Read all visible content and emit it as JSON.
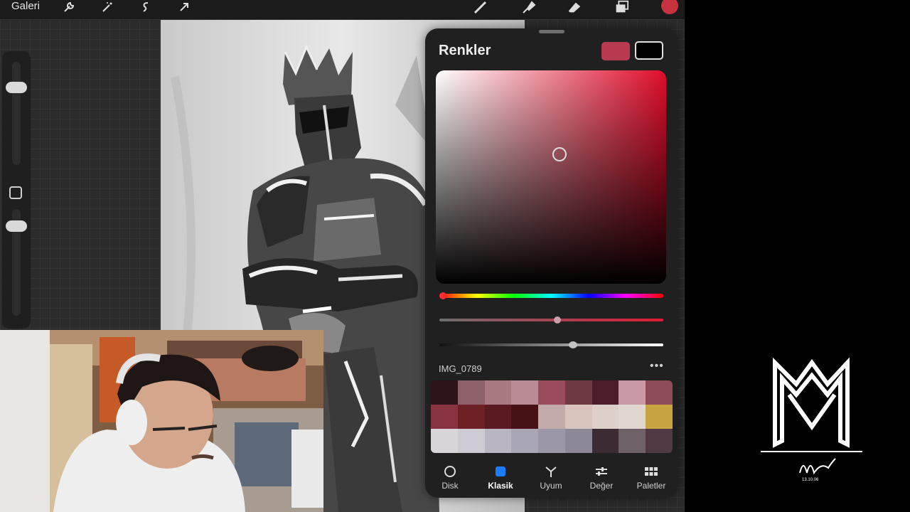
{
  "topbar": {
    "gallery_label": "Galeri",
    "tool_icons": [
      "wrench-icon",
      "magic-wand-icon",
      "selection-s-icon",
      "transform-arrow-icon"
    ],
    "right_icons": [
      "brush-icon",
      "smudge-icon",
      "eraser-icon",
      "layers-icon",
      "color-dot-icon"
    ],
    "color_dot": "#c8313f"
  },
  "color_panel": {
    "title": "Renkler",
    "primary_color": "#b83a4f",
    "secondary_color": "#000000",
    "hue_color": "#e00d2a",
    "palette_name": "IMG_0789",
    "more_label": "•••",
    "palette_rows": [
      [
        "#2d1419",
        "#8e6069",
        "#a97880",
        "#b88b95",
        "#9a4c5d",
        "#6d3a44",
        "#4d1e29",
        "#c99aa6",
        "#8d4a57"
      ],
      [
        "#8a3340",
        "#6d2127",
        "#5a1b20",
        "#471216",
        "#c2aaa8",
        "#d9c3bd",
        "#ddd0c8",
        "#e1d6d0",
        "#c8a441"
      ],
      [
        "#d8d5d8",
        "#cdcad4",
        "#b9b5c3",
        "#a8a5b5",
        "#9c97a8",
        "#8d8797",
        "#3c2b33",
        "#6f6168",
        "#4f3a43"
      ]
    ],
    "tabs": [
      {
        "label": "Disk",
        "icon": "disk-icon"
      },
      {
        "label": "Klasik",
        "icon": "classic-square-icon"
      },
      {
        "label": "Uyum",
        "icon": "harmony-icon"
      },
      {
        "label": "Değer",
        "icon": "value-sliders-icon"
      },
      {
        "label": "Paletler",
        "icon": "palettes-grid-icon"
      }
    ],
    "active_tab": "Klasik",
    "accent": "#1e7bff"
  },
  "logo": {
    "signature": "Murat",
    "date": "13.10.06"
  }
}
